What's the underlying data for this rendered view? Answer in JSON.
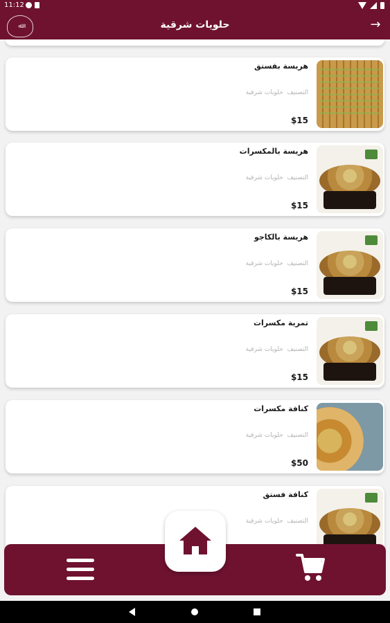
{
  "status_bar": {
    "time": "11:12"
  },
  "app_bar": {
    "title": "حلويات شرقية",
    "back_icon": "→"
  },
  "colors": {
    "brand": "#6e1230",
    "card": "#ffffff",
    "background": "#f2f2f2",
    "muted_text": "#b3b3b3"
  },
  "products": [
    {
      "name": "هريسة بفستق",
      "category_label": "التصنيف",
      "category": "حلويات شرقية",
      "price": "$15",
      "image": "baklava-tray"
    },
    {
      "name": "هريسة بالمكسرات",
      "category_label": "التصنيف",
      "category": "حلويات شرقية",
      "price": "$15",
      "image": "round-tray"
    },
    {
      "name": "هريسة بالكاجو",
      "category_label": "التصنيف",
      "category": "حلويات شرقية",
      "price": "$15",
      "image": "round-tray"
    },
    {
      "name": "تمرية مكسرات",
      "category_label": "التصنيف",
      "category": "حلويات شرقية",
      "price": "$15",
      "image": "round-tray"
    },
    {
      "name": "كنافة مكسرات",
      "category_label": "التصنيف",
      "category": "حلويات شرقية",
      "price": "$50",
      "image": "kunafa-plate"
    },
    {
      "name": "كنافة فستق",
      "category_label": "التصنيف",
      "category": "حلويات شرقية",
      "price": "",
      "image": "round-tray"
    }
  ],
  "bottom_nav": {
    "menu_icon": "menu-icon",
    "home_icon": "home-icon",
    "cart_icon": "cart-icon"
  }
}
